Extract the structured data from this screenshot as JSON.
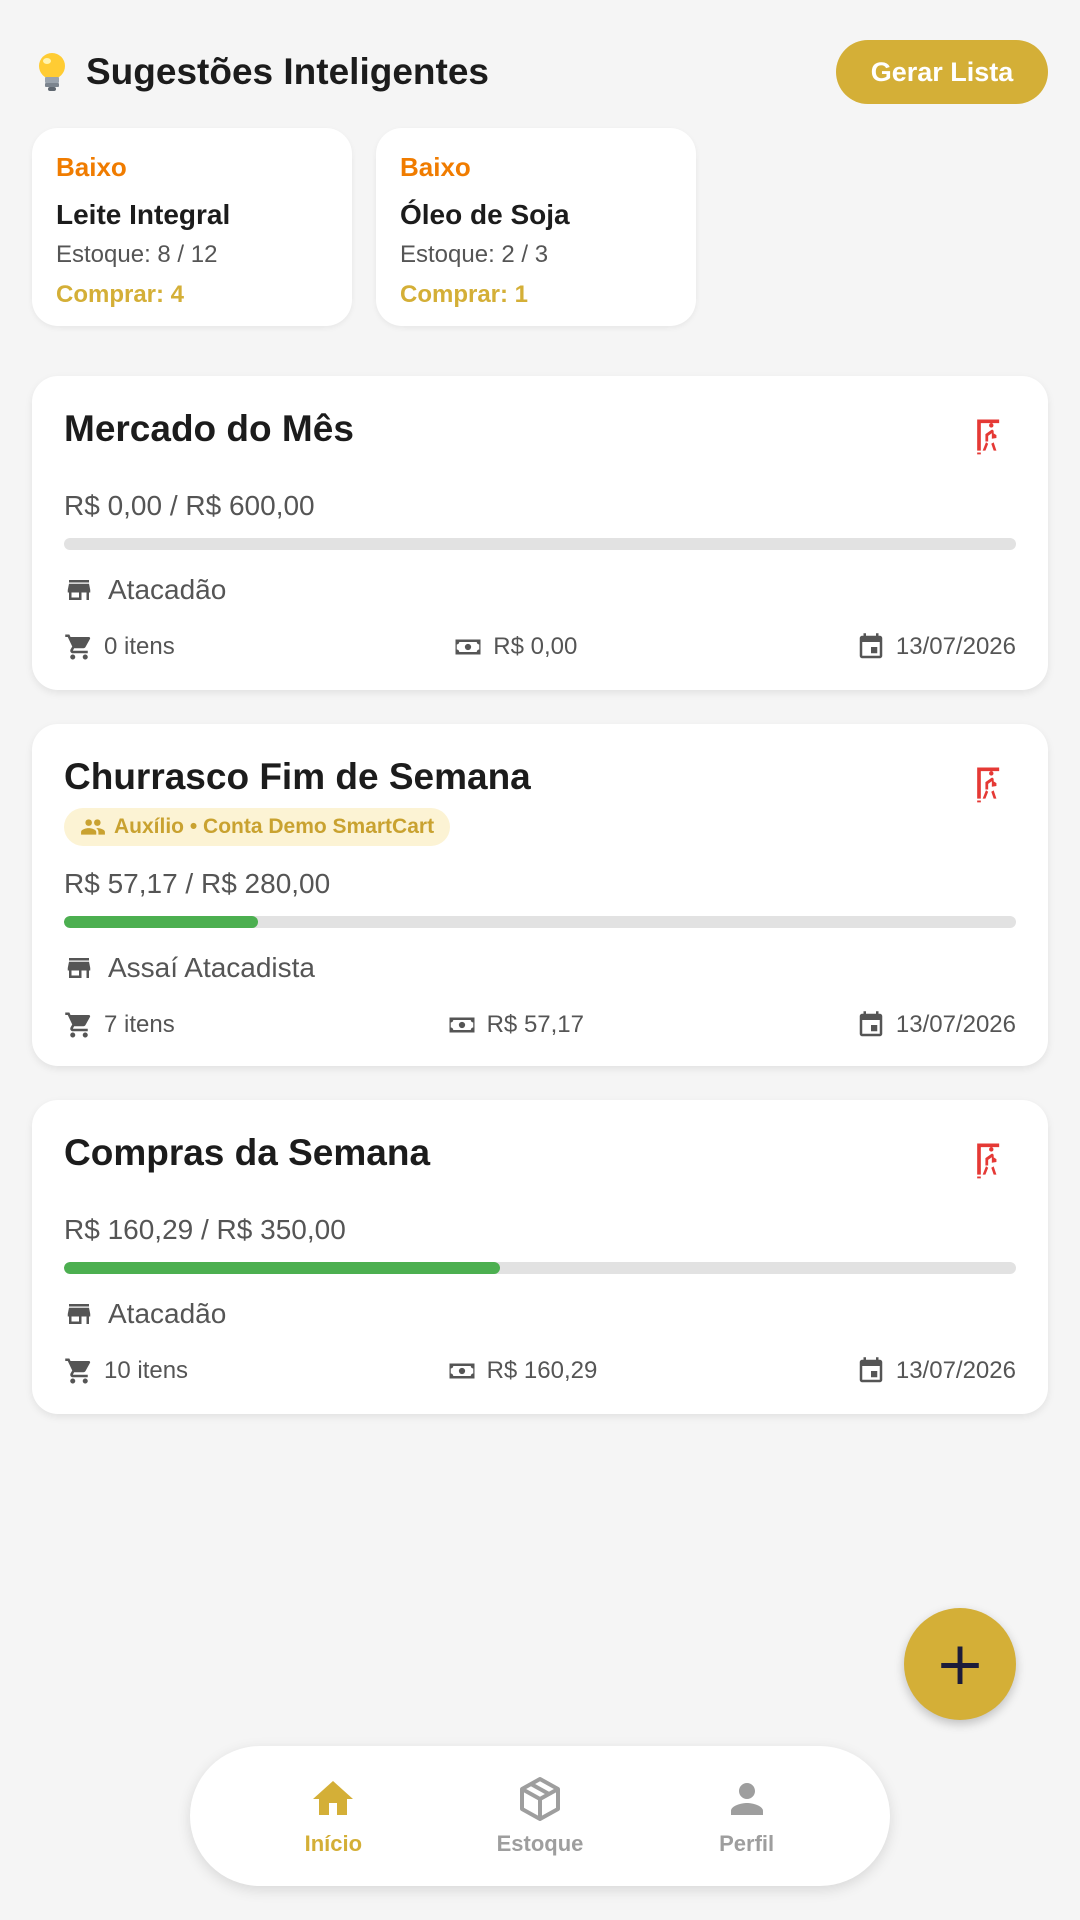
{
  "header": {
    "title": "Sugestões Inteligentes",
    "generate_button": "Gerar Lista"
  },
  "suggestions": [
    {
      "level": "Baixo",
      "name": "Leite Integral",
      "stock": "Estoque: 8 / 12",
      "buy": "Comprar: 4"
    },
    {
      "level": "Baixo",
      "name": "Óleo de Soja",
      "stock": "Estoque: 2 / 3",
      "buy": "Comprar: 1"
    }
  ],
  "lists": [
    {
      "title": "Mercado do Mês",
      "budget": "R$ 0,00 / R$ 600,00",
      "progress": 0.0,
      "store": "Atacadão",
      "items": "0 itens",
      "spent": "R$ 0,00",
      "date": "13/07/2026"
    },
    {
      "title": "Churrasco Fim de Semana",
      "helper": "Auxílio • Conta Demo SmartCart",
      "budget": "R$ 57,17 / R$ 280,00",
      "progress": 0.204,
      "store": "Assaí Atacadista",
      "items": "7 itens",
      "spent": "R$ 57,17",
      "date": "13/07/2026"
    },
    {
      "title": "Compras da Semana",
      "budget": "R$ 160,29 / R$ 350,00",
      "progress": 0.458,
      "store": "Atacadão",
      "items": "10 itens",
      "spent": "R$ 160,29",
      "date": "13/07/2026"
    }
  ],
  "fab_label": "+",
  "nav": [
    {
      "label": "Início",
      "icon": "home-icon",
      "active": true
    },
    {
      "label": "Estoque",
      "icon": "box-icon",
      "active": false
    },
    {
      "label": "Perfil",
      "icon": "person-icon",
      "active": false
    }
  ],
  "colors": {
    "accent": "#d4af37",
    "level_low": "#f07c00",
    "progress": "#4caf50",
    "exit": "#e53935",
    "background": "#f5f5f5"
  }
}
